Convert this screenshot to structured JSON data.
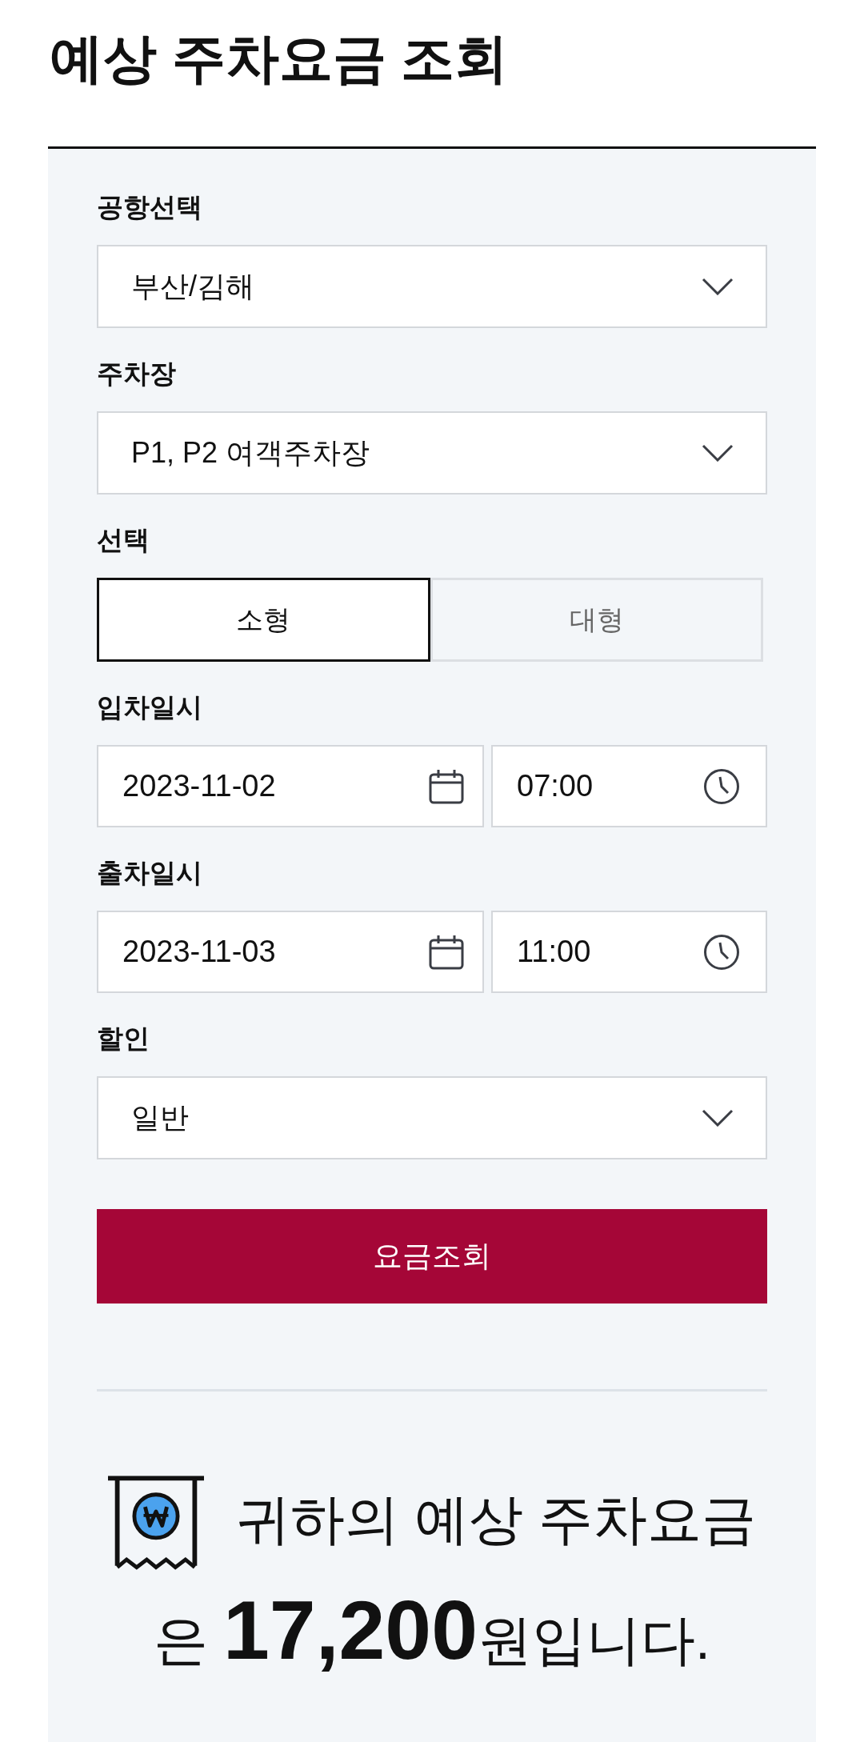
{
  "page": {
    "title": "예상 주차요금 조회"
  },
  "form": {
    "fields": [
      {
        "kind": "select",
        "label": "공항선택",
        "value": "부산/김해"
      },
      {
        "kind": "select",
        "label": "주차장",
        "value": "P1, P2 여객주차장"
      },
      {
        "kind": "toggle",
        "label": "선택",
        "options": [
          {
            "label": "소형",
            "selected": true
          },
          {
            "label": "대형",
            "selected": false
          }
        ]
      },
      {
        "kind": "datetime",
        "label": "입차일시",
        "date": "2023-11-02",
        "time": "07:00"
      },
      {
        "kind": "datetime",
        "label": "출차일시",
        "date": "2023-11-03",
        "time": "11:00"
      },
      {
        "kind": "select",
        "label": "할인",
        "value": "일반"
      }
    ],
    "submit_button": "요금조회"
  },
  "result": {
    "text": "귀하의 예상 주차요금은 **17,200**원입니다."
  }
}
